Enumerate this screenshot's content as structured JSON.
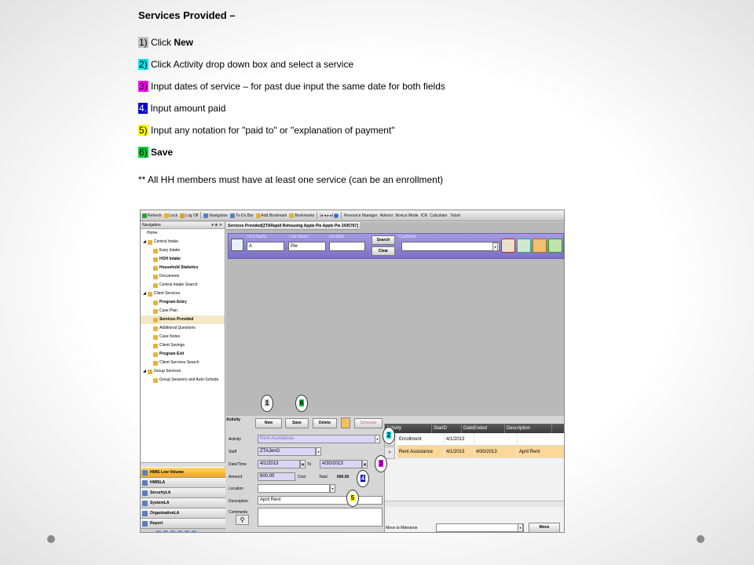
{
  "instructions": {
    "title": "Services Provided –",
    "steps": [
      {
        "num": "1)",
        "text": " Click ",
        "bold": "New"
      },
      {
        "num": "2)",
        "text": " Click Activity drop down box and select a service"
      },
      {
        "num": "3)",
        "text": " Input dates of service – for past due input the same date for both  fields"
      },
      {
        "num": "4.",
        "text": " Input amount paid"
      },
      {
        "num": "5)",
        "text": " Input any notation for \"paid to\" or \"explanation of payment\""
      },
      {
        "num": "6)",
        "text": " ",
        "bold": "Save"
      }
    ],
    "note": "** All HH members must have at least one service (can be an enrollment)"
  },
  "toolbar": {
    "items": [
      "Refresh",
      "Lock",
      "Log Off",
      "Navigation",
      "To-Do Bar",
      "Add Bookmark",
      "Bookmarks",
      "Resource Manager",
      "Advisor",
      "Novice Mode",
      "ICR",
      "Calculator",
      "Ticket"
    ]
  },
  "nav": {
    "header": "Navigation",
    "header_controls": "▾ ⊕ ✕",
    "items": [
      {
        "label": "Home",
        "level": 1
      },
      {
        "label": "Central Intake",
        "level": 0
      },
      {
        "label": "Easy Intake",
        "level": 2
      },
      {
        "label": "HOH Intake",
        "level": 2,
        "bold": true
      },
      {
        "label": "Household Statistics",
        "level": 2,
        "bold": true
      },
      {
        "label": "Documents",
        "level": 2
      },
      {
        "label": "Central Intake Search",
        "level": 2
      },
      {
        "label": "Client Services",
        "level": 0
      },
      {
        "label": "Program Entry",
        "level": 2,
        "bold": true
      },
      {
        "label": "Case Plan",
        "level": 2
      },
      {
        "label": "Services Provided",
        "level": 2,
        "bold": true,
        "selected": true
      },
      {
        "label": "Additional Questions",
        "level": 2
      },
      {
        "label": "Case Notes",
        "level": 2
      },
      {
        "label": "Client Savings",
        "level": 2
      },
      {
        "label": "Program Exit",
        "level": 2,
        "bold": true
      },
      {
        "label": "Client Services Search",
        "level": 2
      },
      {
        "label": "Group Services",
        "level": 0
      },
      {
        "label": "Group Sessions and Auto-Schedu",
        "level": 2
      }
    ],
    "modules": [
      "HMIS Low Volume",
      "HMISLA",
      "SecurityLA",
      "SystemLA",
      "OrganizationLA",
      "Report"
    ]
  },
  "doc_tab": "Services Provided[ZTARapid Rehousing Apple Pie Apple Pie 2435767]",
  "search": {
    "labels": {
      "first": "First Name",
      "last": "Last Name",
      "identifier": "Identifier",
      "customer": "Customer"
    },
    "first_value": "A",
    "last_value": "Pie",
    "identifier_value": "",
    "search_button": "Search",
    "clear_button": "Clear"
  },
  "activity": {
    "header": "Activity",
    "buttons": {
      "new": "New",
      "save": "Save",
      "delete": "Delete",
      "schedule": "Schedule"
    },
    "labels": {
      "activity": "Activity",
      "staff": "Staff",
      "datetime": "Date/Time",
      "to": "To",
      "amount": "Amount",
      "cost": "Cost",
      "total": "Total:",
      "location": "Location",
      "description": "Description",
      "comments": "Comments"
    },
    "values": {
      "activity": "Rent Assistance",
      "staff": "ZTAJenG",
      "date_from": "4/1/2013",
      "date_to": "4/30/2013",
      "amount": "600.00",
      "total": "600.00",
      "description": "April Rent"
    }
  },
  "grid": {
    "columns": [
      "Activity",
      "StartD",
      "DateEnded",
      "Description"
    ],
    "rows": [
      [
        "Enrollment",
        "4/1/2013",
        "",
        ""
      ],
      [
        "Rent Assistance",
        "4/1/2013",
        "4/30/2013",
        "April Rent"
      ]
    ],
    "milestone_label": "Move to Milestone",
    "move_button": "Move"
  },
  "callouts": [
    "1",
    "6",
    "2",
    "3",
    "4",
    "5"
  ]
}
